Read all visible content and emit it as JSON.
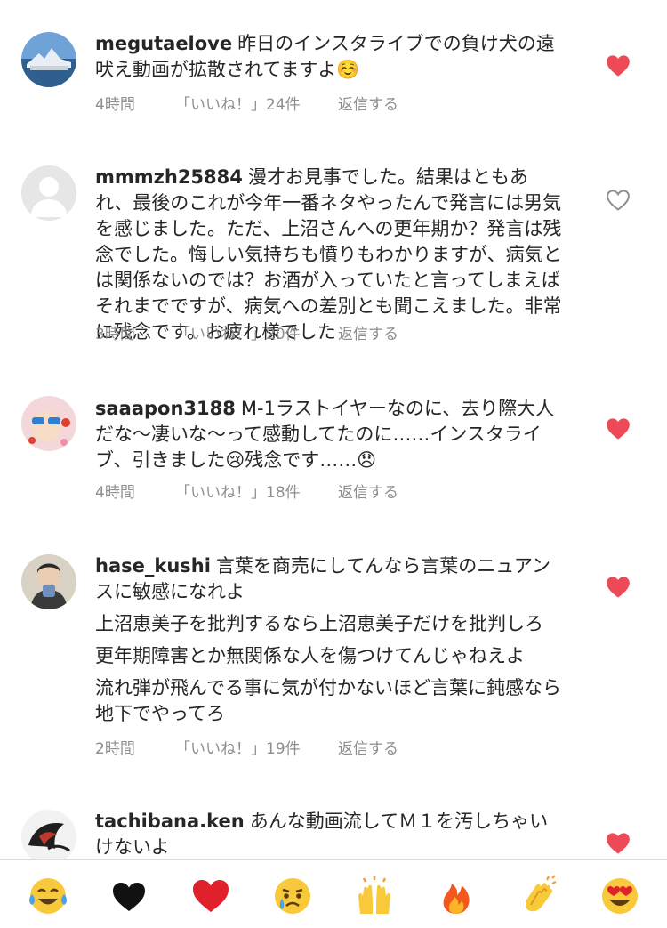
{
  "comments": [
    {
      "username": "megutaelove",
      "text": "昨日のインスタライブでの負け犬の遠吠え動画が拡散されてますよ☺️",
      "extra_lines": [],
      "time": "4時間",
      "likes": "「いいね！」24件",
      "reply": "返信する",
      "liked": true
    },
    {
      "username": "mmmzh25884",
      "text": "漫才お見事でした。結果はともあれ、最後のこれが今年一番ネタやったんで発言には男気を感じました。ただ、上沼さんへの更年期か？発言は残念でした。悔しい気持ちも憤りもわかりますが、病気とは関係ないのでは？お酒が入っていたと言ってしまえばそれまでですが、病気への差別とも聞こえました。非常に残念です。お疲れ様でした",
      "extra_lines": [],
      "time": "3時間",
      "likes": "「いいね！」20件",
      "reply": "返信する",
      "liked": false
    },
    {
      "username": "saaapon3188",
      "text": "M-1ラストイヤーなのに、去り際大人だな〜凄いな〜って感動してたのに……インスタライブ、引きました😢残念です……😞",
      "extra_lines": [],
      "time": "4時間",
      "likes": "「いいね！」18件",
      "reply": "返信する",
      "liked": true
    },
    {
      "username": "hase_kushi",
      "text": "言葉を商売にしてんなら言葉のニュアンスに敏感になれよ",
      "extra_lines": [
        "上沼恵美子を批判するなら上沼恵美子だけを批判しろ",
        "更年期障害とか無関係な人を傷つけてんじゃねえよ",
        "流れ弾が飛んでる事に気が付かないほど言葉に鈍感なら地下でやってろ"
      ],
      "time": "2時間",
      "likes": "「いいね！」19件",
      "reply": "返信する",
      "liked": true
    },
    {
      "username": "tachibana.ken",
      "text": "あんな動画流してＭ１を汚しちゃいけないよ",
      "extra_lines": [],
      "time": "",
      "likes": "",
      "reply": "",
      "liked": true
    }
  ],
  "icons": {
    "liked_heart": "filled-heart-icon",
    "unliked_heart": "outline-heart-icon",
    "liked_color": "#ed4956",
    "unliked_color": "#8e8e8e"
  },
  "emoji_bar": [
    {
      "name": "tears-of-joy-emoji",
      "char": "😂"
    },
    {
      "name": "black-heart-emoji",
      "char": "🖤"
    },
    {
      "name": "red-heart-emoji",
      "char": "❤️"
    },
    {
      "name": "crying-face-emoji",
      "char": "😢"
    },
    {
      "name": "raising-hands-emoji",
      "char": "🙌"
    },
    {
      "name": "fire-emoji",
      "char": "🔥"
    },
    {
      "name": "clapping-hands-emoji",
      "char": "👏"
    },
    {
      "name": "heart-eyes-emoji",
      "char": "😍"
    }
  ]
}
